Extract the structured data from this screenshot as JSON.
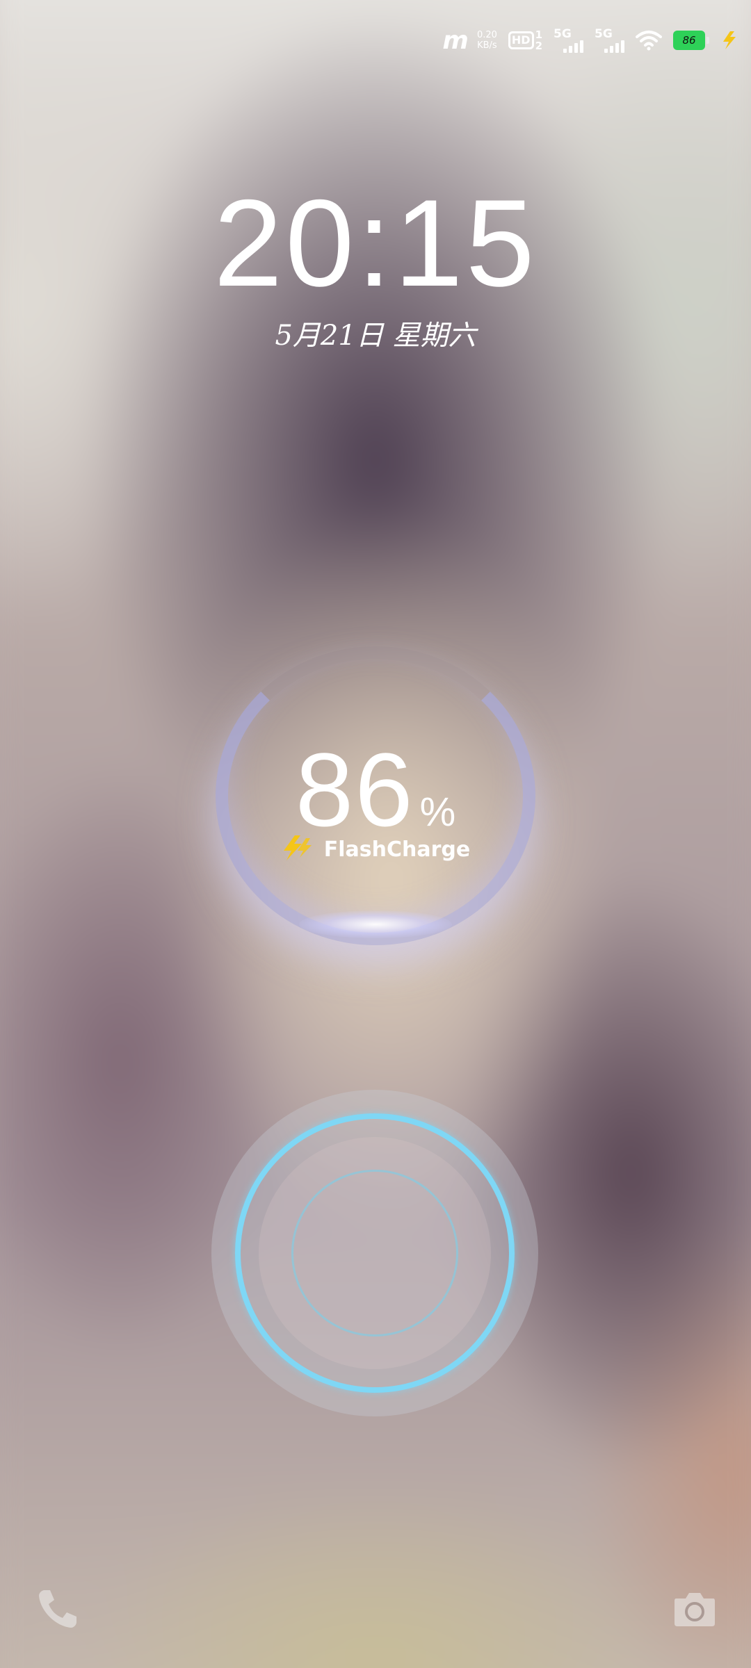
{
  "status_bar": {
    "carrier_logo": "m",
    "net_speed_value": "0.20",
    "net_speed_unit": "KB/s",
    "hd_label": "HD",
    "hd_sim_1": "1",
    "hd_sim_2": "2",
    "sim1_network": "5G",
    "sim2_network": "5G",
    "battery_level": "86",
    "battery_color": "#2ed158",
    "charging_bolt_color": "#f5c518"
  },
  "lockscreen": {
    "time": "20:15",
    "date": "5月21日  星期六"
  },
  "charging": {
    "percent": "86",
    "percent_sign": "%",
    "mode_label": "FlashCharge",
    "ring_color": "#aeb2f5"
  },
  "fingerprint": {
    "ring_color": "#7fd7f5"
  },
  "shortcuts": {
    "left_icon": "phone-icon",
    "right_icon": "camera-icon"
  }
}
